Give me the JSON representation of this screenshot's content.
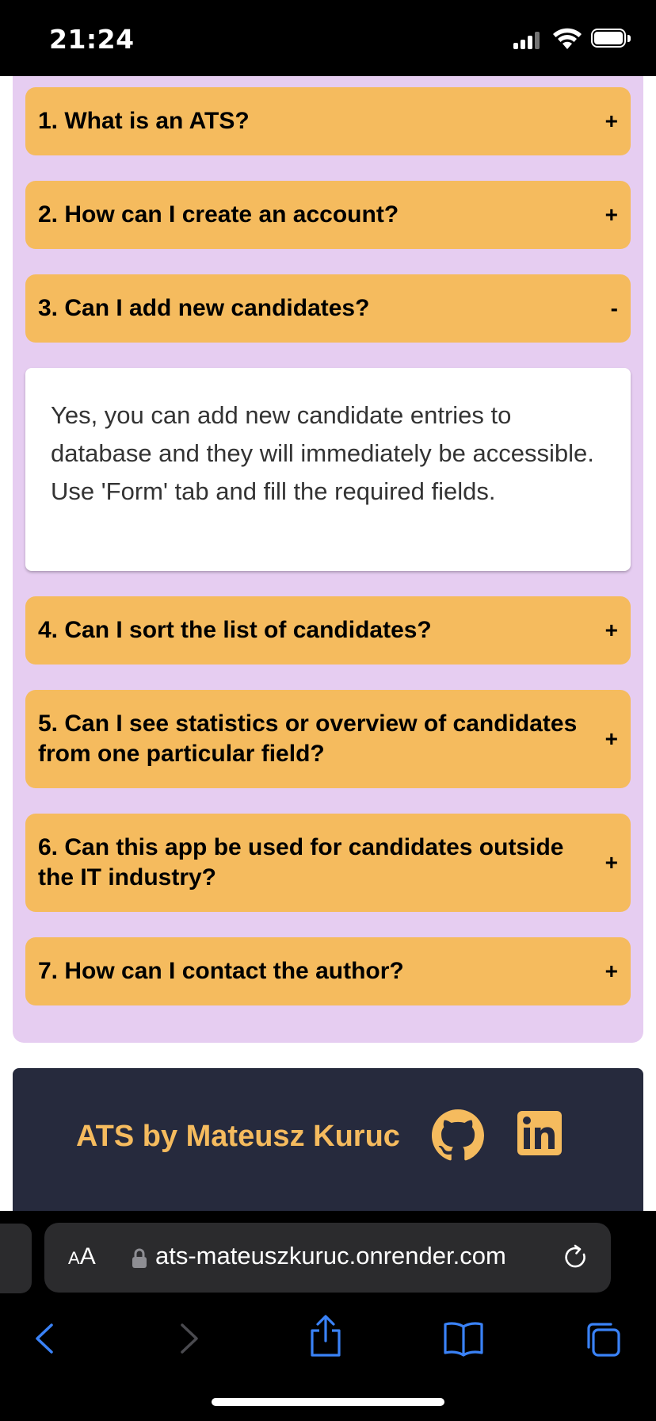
{
  "status_bar": {
    "time": "21:24"
  },
  "faq": {
    "items": [
      {
        "question": "1. What is an ATS?",
        "toggle": "+"
      },
      {
        "question": "2. How can I create an account?",
        "toggle": "+"
      },
      {
        "question": "3. Can I add new candidates?",
        "toggle": "-"
      },
      {
        "question": "4. Can I sort the list of candidates?",
        "toggle": "+"
      },
      {
        "question": "5. Can I see statistics or overview of candidates from one particular field?",
        "toggle": "+"
      },
      {
        "question": "6. Can this app be used for candidates outside the IT industry?",
        "toggle": "+"
      },
      {
        "question": "7. How can I contact the author?",
        "toggle": "+"
      }
    ],
    "open_answer": "Yes, you can add new candidate entries to database and they will immediately be accessible. Use 'Form' tab and fill the required fields."
  },
  "footer": {
    "title": "ATS by Mateusz Kuruc"
  },
  "browser": {
    "aa_label_small": "A",
    "aa_label_large": "A",
    "url": "ats-mateuszkuruc.onrender.com"
  },
  "colors": {
    "panel_bg": "#e6cdf1",
    "accordion_bg": "#f5bb5e",
    "footer_bg": "#262a3d",
    "footer_text": "#f5bb5e",
    "safari_accent": "#3a82f7"
  },
  "icons": [
    "github-icon",
    "linkedin-icon",
    "lock-icon",
    "reload-icon",
    "back-icon",
    "forward-icon",
    "share-icon",
    "bookmarks-icon",
    "tabs-icon"
  ]
}
